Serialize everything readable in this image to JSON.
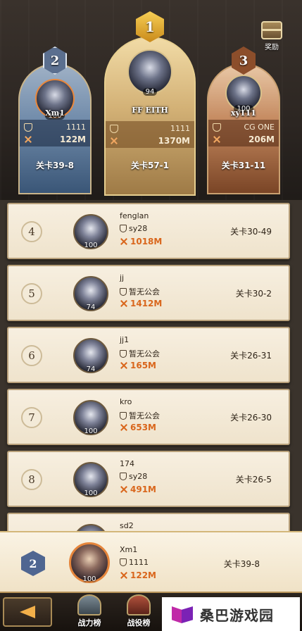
{
  "podium": [
    {
      "rank": "2",
      "name": "Xm1",
      "level": "100",
      "guild": "1111",
      "power": "122M",
      "stage": "关卡39-8"
    },
    {
      "rank": "1",
      "name": "FF EITH",
      "level": "94",
      "guild": "1111",
      "power": "1370M",
      "stage": "关卡57-1"
    },
    {
      "rank": "3",
      "name": "xy111",
      "level": "100",
      "guild": "CG ONE",
      "power": "206M",
      "stage": "关卡31-11"
    }
  ],
  "reward": {
    "label": "奖励"
  },
  "rows": [
    {
      "rank": "4",
      "name": "fenglan",
      "level": "100",
      "guild": "sy28",
      "power": "1018M",
      "stage": "关卡30-49"
    },
    {
      "rank": "5",
      "name": "jj",
      "level": "74",
      "guild": "暂无公会",
      "power": "1412M",
      "stage": "关卡30-2"
    },
    {
      "rank": "6",
      "name": "jj1",
      "level": "74",
      "guild": "暂无公会",
      "power": "165M",
      "stage": "关卡26-31"
    },
    {
      "rank": "7",
      "name": "kro",
      "level": "100",
      "guild": "暂无公会",
      "power": "653M",
      "stage": "关卡26-30"
    },
    {
      "rank": "8",
      "name": "174",
      "level": "100",
      "guild": "sy28",
      "power": "491M",
      "stage": "关卡26-5"
    },
    {
      "rank": "",
      "name": "sd2",
      "level": "",
      "guild": "",
      "power": "",
      "stage": ""
    }
  ],
  "mine": {
    "rank": "2",
    "name": "Xm1",
    "level": "100",
    "guild": "1111",
    "power": "122M",
    "stage": "关卡39-8"
  },
  "tabs": [
    {
      "label": "战力榜"
    },
    {
      "label": "战役榜"
    }
  ],
  "watermark": {
    "text": "桑巴游戏园"
  }
}
